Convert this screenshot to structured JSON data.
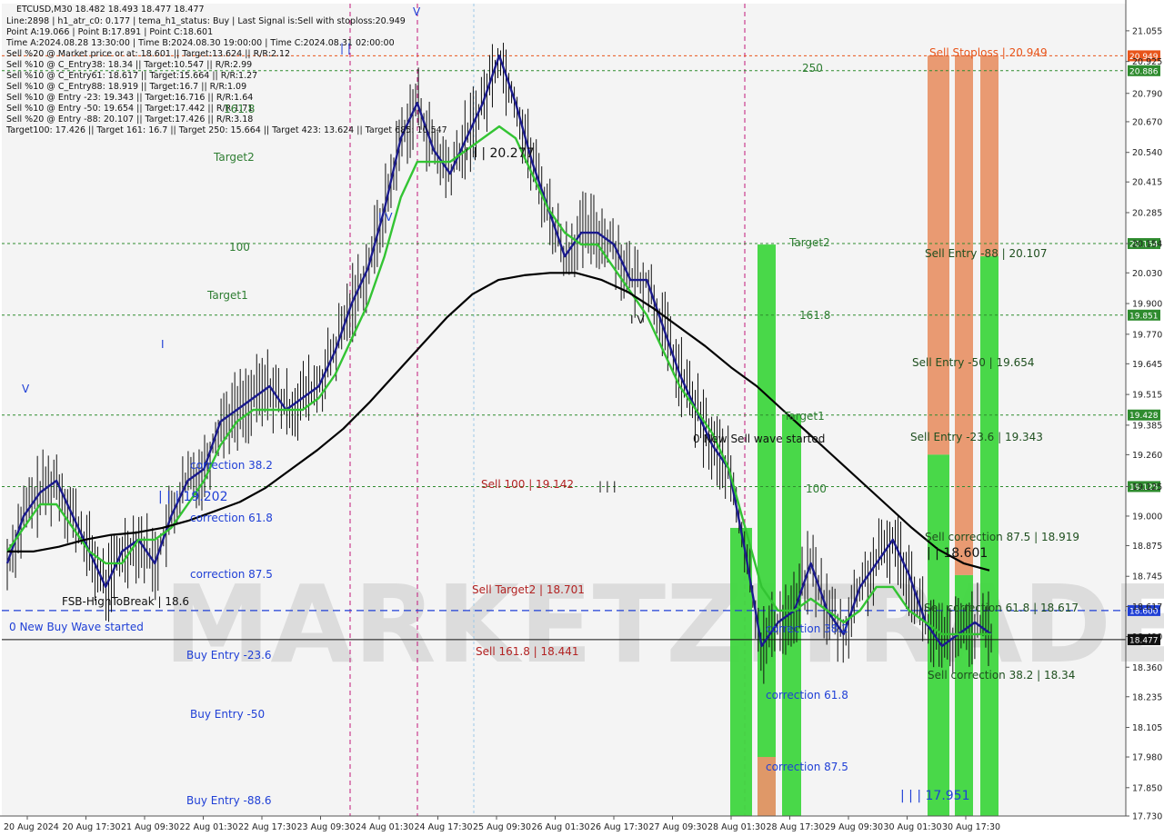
{
  "chart_data": {
    "type": "candlestick",
    "symbol_line": "ETCUSD,M30  18.482 18.493 18.477 18.477",
    "info_lines": [
      "Line:2898  |  h1_atr_c0: 0.177  |  tema_h1_status: Buy  |  Last Signal is:Sell with stoploss:20.949",
      "Point A:19.066  |  Point B:17.891  |  Point C:18.601",
      "Time A:2024.08.28 13:30:00  |  Time B:2024.08.30 19:00:00  |  Time C:2024.08.31 02:00:00",
      "Sell %20 @ Market price or at: 18.601  ||  Target:13.624  ||  R/R:2.12",
      "Sell %10 @ C_Entry38: 18.34  ||  Target:10.547  ||  R/R:2.99",
      "Sell %10 @ C_Entry61: 18.617  ||  Target:15.664  ||  R/R:1.27",
      "Sell %10 @ C_Entry88: 18.919  ||  Target:16.7  ||  R/R:1.09",
      "Sell %10 @ Entry -23: 19.343  ||  Target:16.716  ||  R/R:1.64",
      "Sell %10 @ Entry -50: 19.654  ||  Target:17.442  ||  R/R:1.71",
      "Sell %20 @ Entry -88: 20.107  ||  Target:17.426  ||  R/R:3.18",
      "Target100: 17.426  ||  Target 161: 16.7  ||  Target 250: 15.664  ||  Target 423: 13.624  ||  Target 685: 10.547"
    ],
    "watermark": "MARKETZITRADE",
    "ylim": [
      17.73,
      21.17
    ],
    "y_ticks": [
      21.055,
      20.925,
      20.79,
      20.67,
      20.54,
      20.415,
      20.285,
      20.154,
      20.03,
      19.9,
      19.77,
      19.645,
      19.515,
      19.385,
      19.26,
      19.125,
      19.0,
      18.875,
      18.745,
      18.617,
      18.49,
      18.36,
      18.235,
      18.105,
      17.98,
      17.85,
      17.73
    ],
    "x_labels": [
      "20 Aug 2024",
      "20 Aug 17:30",
      "21 Aug 09:30",
      "22 Aug 01:30",
      "22 Aug 17:30",
      "23 Aug 09:30",
      "24 Aug 01:30",
      "24 Aug 17:30",
      "25 Aug 09:30",
      "26 Aug 01:30",
      "26 Aug 17:30",
      "27 Aug 09:30",
      "28 Aug 01:30",
      "28 Aug 17:30",
      "29 Aug 09:30",
      "30 Aug 01:30",
      "30 Aug 17:30"
    ],
    "current_price": 18.477,
    "horizontal_levels": [
      {
        "value": 20.949,
        "tag": "20.949",
        "color": "#e8541a",
        "style": "dotted"
      },
      {
        "value": 20.886,
        "tag": "20.886",
        "color": "#2e8b2e",
        "style": "dotted"
      },
      {
        "value": 20.154,
        "tag": "20.154",
        "color": "#2e8b2e",
        "style": "dotted"
      },
      {
        "value": 19.851,
        "tag": "19.851",
        "color": "#2e8b2e",
        "style": "dotted"
      },
      {
        "value": 19.428,
        "tag": "19.428",
        "color": "#2e8b2e",
        "style": "dotted"
      },
      {
        "value": 19.125,
        "tag": "19.125",
        "color": "#2e8b2e",
        "style": "dotted"
      },
      {
        "value": 18.6,
        "tag": "18.600",
        "color": "#1f3fd6",
        "style": "dashed"
      },
      {
        "value": 18.477,
        "tag": "18.477",
        "color": "#111111",
        "style": "solid"
      }
    ],
    "annotations": [
      {
        "text": "Sell Stoploss | 20.949",
        "color": "#e8541a"
      },
      {
        "text": "250",
        "color": "#2e7d32"
      },
      {
        "text": "| | | 20.277",
        "color": "#111111"
      },
      {
        "text": "Target2",
        "color": "#2e7d32"
      },
      {
        "text": "100",
        "color": "#2e7d32"
      },
      {
        "text": "Target1",
        "color": "#2e7d32"
      },
      {
        "text": "161.8",
        "color": "#2e7d32"
      },
      {
        "text": "Target2",
        "color": "#2e7d32"
      },
      {
        "text": "Sell Entry -88 | 20.107",
        "color": "#1f4f1f"
      },
      {
        "text": "161.8",
        "color": "#2e7d32"
      },
      {
        "text": "I V",
        "color": "#111111"
      },
      {
        "text": "Sell Entry -50 | 19.654",
        "color": "#1f4f1f"
      },
      {
        "text": "Target1",
        "color": "#2e7d32"
      },
      {
        "text": "0 New Sell wave started",
        "color": "#111111"
      },
      {
        "text": "Sell Entry -23.6 | 19.343",
        "color": "#1f4f1f"
      },
      {
        "text": "correction 38.2",
        "color": "#1f3fd6"
      },
      {
        "text": "Sell 100 | 19.142",
        "color": "#b22222"
      },
      {
        "text": "| | |",
        "color": "#111111"
      },
      {
        "text": "100",
        "color": "#2e7d32"
      },
      {
        "text": "| | | 19.202",
        "color": "#1f3fd6"
      },
      {
        "text": "correction 61.8",
        "color": "#1f3fd6"
      },
      {
        "text": "Sell correction 87.5 | 18.919",
        "color": "#1f4f1f"
      },
      {
        "text": "| | 18.601",
        "color": "#111111"
      },
      {
        "text": "correction 87.5",
        "color": "#1f3fd6"
      },
      {
        "text": "Sell Target2 | 18.701",
        "color": "#b22222"
      },
      {
        "text": "FSB-HighToBreak | 18.6",
        "color": "#111111"
      },
      {
        "text": "Sell correction 61.8 | 18.617",
        "color": "#1f4f1f"
      },
      {
        "text": "0 New Buy Wave started",
        "color": "#1f3fd6"
      },
      {
        "text": "correction 38.2",
        "color": "#1f3fd6"
      },
      {
        "text": "Buy Entry -23.6",
        "color": "#1f3fd6"
      },
      {
        "text": "Sell 161.8 | 18.441",
        "color": "#b22222"
      },
      {
        "text": "Sell correction 38.2 | 18.34",
        "color": "#1f4f1f"
      },
      {
        "text": "correction 61.8",
        "color": "#1f3fd6"
      },
      {
        "text": "Buy Entry -50",
        "color": "#1f3fd6"
      },
      {
        "text": "correction 87.5",
        "color": "#1f3fd6"
      },
      {
        "text": "| | | 17.951",
        "color": "#1f3fd6"
      },
      {
        "text": "Buy Entry -88.6",
        "color": "#1f3fd6"
      },
      {
        "text": "V",
        "color": "#1f3fd6"
      },
      {
        "text": "V",
        "color": "#1f3fd6"
      },
      {
        "text": "I",
        "color": "#1f3fd6"
      },
      {
        "text": "I V",
        "color": "#1f3fd6"
      },
      {
        "text": "| |",
        "color": "#1f3fd6"
      }
    ],
    "colors": {
      "ma_fast": "#1a1a8c",
      "ma_mid": "#33c433",
      "ma_slow": "#000000",
      "bar_green": "#3fd63f",
      "bar_orange": "#e8956a",
      "current_line": "#1f3fd6"
    },
    "series": [
      {
        "name": "",
        "values": [
          18.8,
          19.0,
          19.1,
          19.15,
          19.0,
          18.85,
          18.7,
          18.85,
          18.9,
          18.8,
          19.0,
          19.15,
          19.2,
          19.4,
          19.45,
          19.5,
          19.55,
          19.45,
          19.5,
          19.55,
          19.7,
          19.9,
          20.05,
          20.3,
          20.6,
          20.75,
          20.55,
          20.45,
          20.6,
          20.75,
          20.95,
          20.75,
          20.5,
          20.3,
          20.1,
          20.2,
          20.2,
          20.15,
          20.0,
          20.0,
          19.8,
          19.6,
          19.45,
          19.3,
          19.2,
          18.85,
          18.45,
          18.55,
          18.6,
          18.8,
          18.6,
          18.5,
          18.7,
          18.8,
          18.9,
          18.75,
          18.55,
          18.45,
          18.5,
          18.55,
          18.5
        ]
      },
      {
        "name": "",
        "values": [
          18.85,
          18.95,
          19.05,
          19.05,
          18.95,
          18.85,
          18.8,
          18.8,
          18.9,
          18.9,
          18.95,
          19.05,
          19.15,
          19.3,
          19.4,
          19.45,
          19.45,
          19.45,
          19.45,
          19.5,
          19.6,
          19.75,
          19.9,
          20.1,
          20.35,
          20.5,
          20.5,
          20.5,
          20.55,
          20.6,
          20.65,
          20.6,
          20.45,
          20.3,
          20.2,
          20.15,
          20.15,
          20.05,
          19.95,
          19.85,
          19.7,
          19.55,
          19.45,
          19.35,
          19.2,
          18.95,
          18.7,
          18.6,
          18.6,
          18.65,
          18.6,
          18.55,
          18.6,
          18.7,
          18.7,
          18.6,
          18.55,
          18.5,
          18.5,
          18.5,
          18.5
        ]
      },
      {
        "name": "",
        "values": [
          18.85,
          18.85,
          18.87,
          18.9,
          18.92,
          18.93,
          18.95,
          18.98,
          19.02,
          19.06,
          19.12,
          19.2,
          19.28,
          19.37,
          19.48,
          19.6,
          19.72,
          19.84,
          19.94,
          20.0,
          20.02,
          20.03,
          20.03,
          20.0,
          19.95,
          19.88,
          19.8,
          19.72,
          19.63,
          19.55,
          19.45,
          19.35,
          19.25,
          19.15,
          19.05,
          18.95,
          18.86,
          18.8,
          18.77
        ]
      }
    ]
  }
}
